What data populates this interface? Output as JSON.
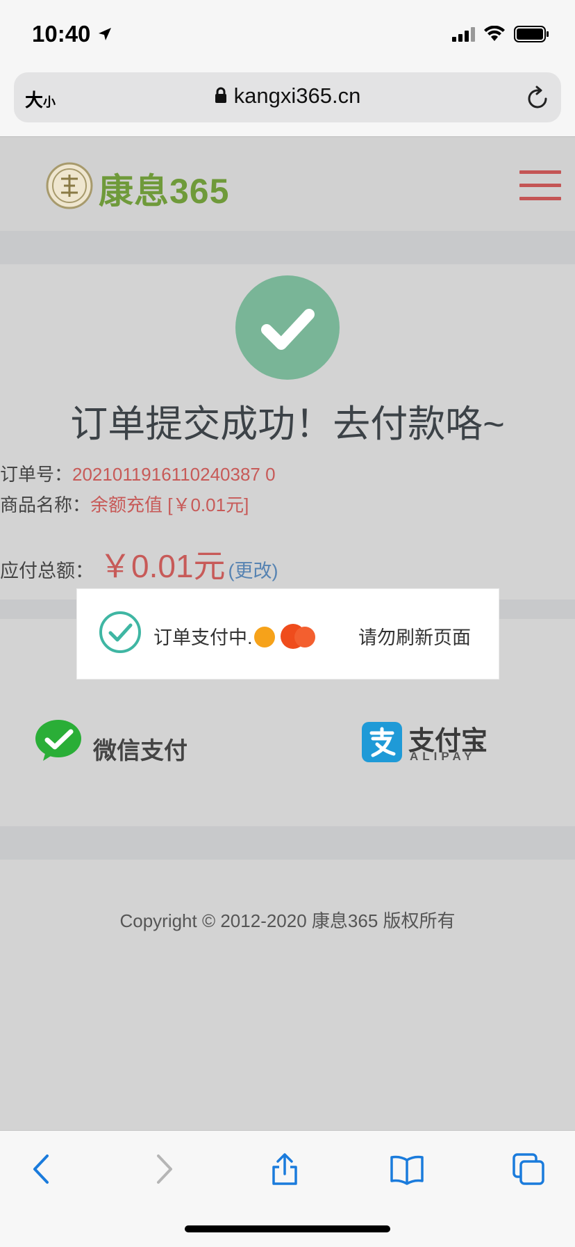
{
  "status_bar": {
    "time": "10:40"
  },
  "safari": {
    "text_size_big": "大",
    "text_size_small": "小",
    "domain": "kangxi365.cn"
  },
  "header": {
    "logo_text": "康息365"
  },
  "success": {
    "title": "订单提交成功！去付款咯~"
  },
  "order": {
    "number_label": "订单号：",
    "number_value": "2021011916110240387 0",
    "product_label": "商品名称：",
    "product_value": "余额充值 [￥0.01元]",
    "amount_label": "应付总额：",
    "amount_value": "￥0.01元",
    "change_link": "(更改)"
  },
  "toast": {
    "message": "订单支付中.",
    "note": "请勿刷新页面"
  },
  "payment": {
    "wechat_label": "微信支付",
    "alipay_cn": "支付宝",
    "alipay_en": "ALIPAY"
  },
  "footer": {
    "copyright": "Copyright © 2012-2020 康息365 版权所有"
  },
  "colors": {
    "accent_red": "#c75a58",
    "success_green": "#79b597",
    "brand_green": "#6f9a3a"
  }
}
